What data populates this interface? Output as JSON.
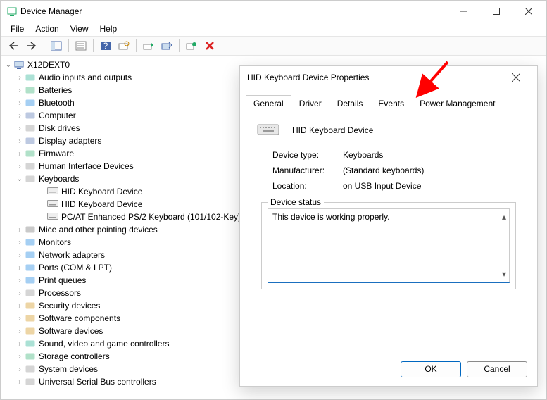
{
  "window": {
    "title": "Device Manager",
    "menu": [
      "File",
      "Action",
      "View",
      "Help"
    ]
  },
  "root_node": "X12DEXT0",
  "categories": [
    {
      "label": "Audio inputs and outputs",
      "expanded": false
    },
    {
      "label": "Batteries",
      "expanded": false
    },
    {
      "label": "Bluetooth",
      "expanded": false
    },
    {
      "label": "Computer",
      "expanded": false
    },
    {
      "label": "Disk drives",
      "expanded": false
    },
    {
      "label": "Display adapters",
      "expanded": false
    },
    {
      "label": "Firmware",
      "expanded": false
    },
    {
      "label": "Human Interface Devices",
      "expanded": false
    },
    {
      "label": "Keyboards",
      "expanded": true,
      "children": [
        {
          "label": "HID Keyboard Device"
        },
        {
          "label": "HID Keyboard Device"
        },
        {
          "label": "PC/AT Enhanced PS/2 Keyboard (101/102-Key)"
        }
      ]
    },
    {
      "label": "Mice and other pointing devices",
      "expanded": false
    },
    {
      "label": "Monitors",
      "expanded": false
    },
    {
      "label": "Network adapters",
      "expanded": false
    },
    {
      "label": "Ports (COM & LPT)",
      "expanded": false
    },
    {
      "label": "Print queues",
      "expanded": false
    },
    {
      "label": "Processors",
      "expanded": false
    },
    {
      "label": "Security devices",
      "expanded": false
    },
    {
      "label": "Software components",
      "expanded": false
    },
    {
      "label": "Software devices",
      "expanded": false
    },
    {
      "label": "Sound, video and game controllers",
      "expanded": false
    },
    {
      "label": "Storage controllers",
      "expanded": false
    },
    {
      "label": "System devices",
      "expanded": false
    },
    {
      "label": "Universal Serial Bus controllers",
      "expanded": false
    }
  ],
  "dialog": {
    "title": "HID Keyboard Device Properties",
    "tabs": [
      "General",
      "Driver",
      "Details",
      "Events",
      "Power Management"
    ],
    "active_tab": 0,
    "device_name": "HID Keyboard Device",
    "rows": {
      "device_type": {
        "k": "Device type:",
        "v": "Keyboards"
      },
      "manufacturer": {
        "k": "Manufacturer:",
        "v": "(Standard keyboards)"
      },
      "location": {
        "k": "Location:",
        "v": "on USB Input Device"
      }
    },
    "status_legend": "Device status",
    "status_text": "This device is working properly.",
    "ok": "OK",
    "cancel": "Cancel"
  },
  "icons": {
    "app": "devmgr-icon",
    "computer": "computer-icon",
    "audio": "audio-icon",
    "battery": "battery-icon",
    "bluetooth": "bluetooth-icon",
    "disk": "disk-icon",
    "display": "display-icon",
    "firmware": "firmware-icon",
    "hid": "hid-icon",
    "keyboard": "keyboard-icon",
    "mouse": "mouse-icon",
    "monitor": "monitor-icon",
    "network": "network-icon",
    "ports": "ports-icon",
    "print": "print-icon",
    "processor": "processor-icon",
    "security": "security-icon",
    "softcomp": "softcomp-icon",
    "softdev": "softdev-icon",
    "sound": "sound-icon",
    "storage": "storage-icon",
    "system": "system-icon",
    "usb": "usb-icon"
  }
}
